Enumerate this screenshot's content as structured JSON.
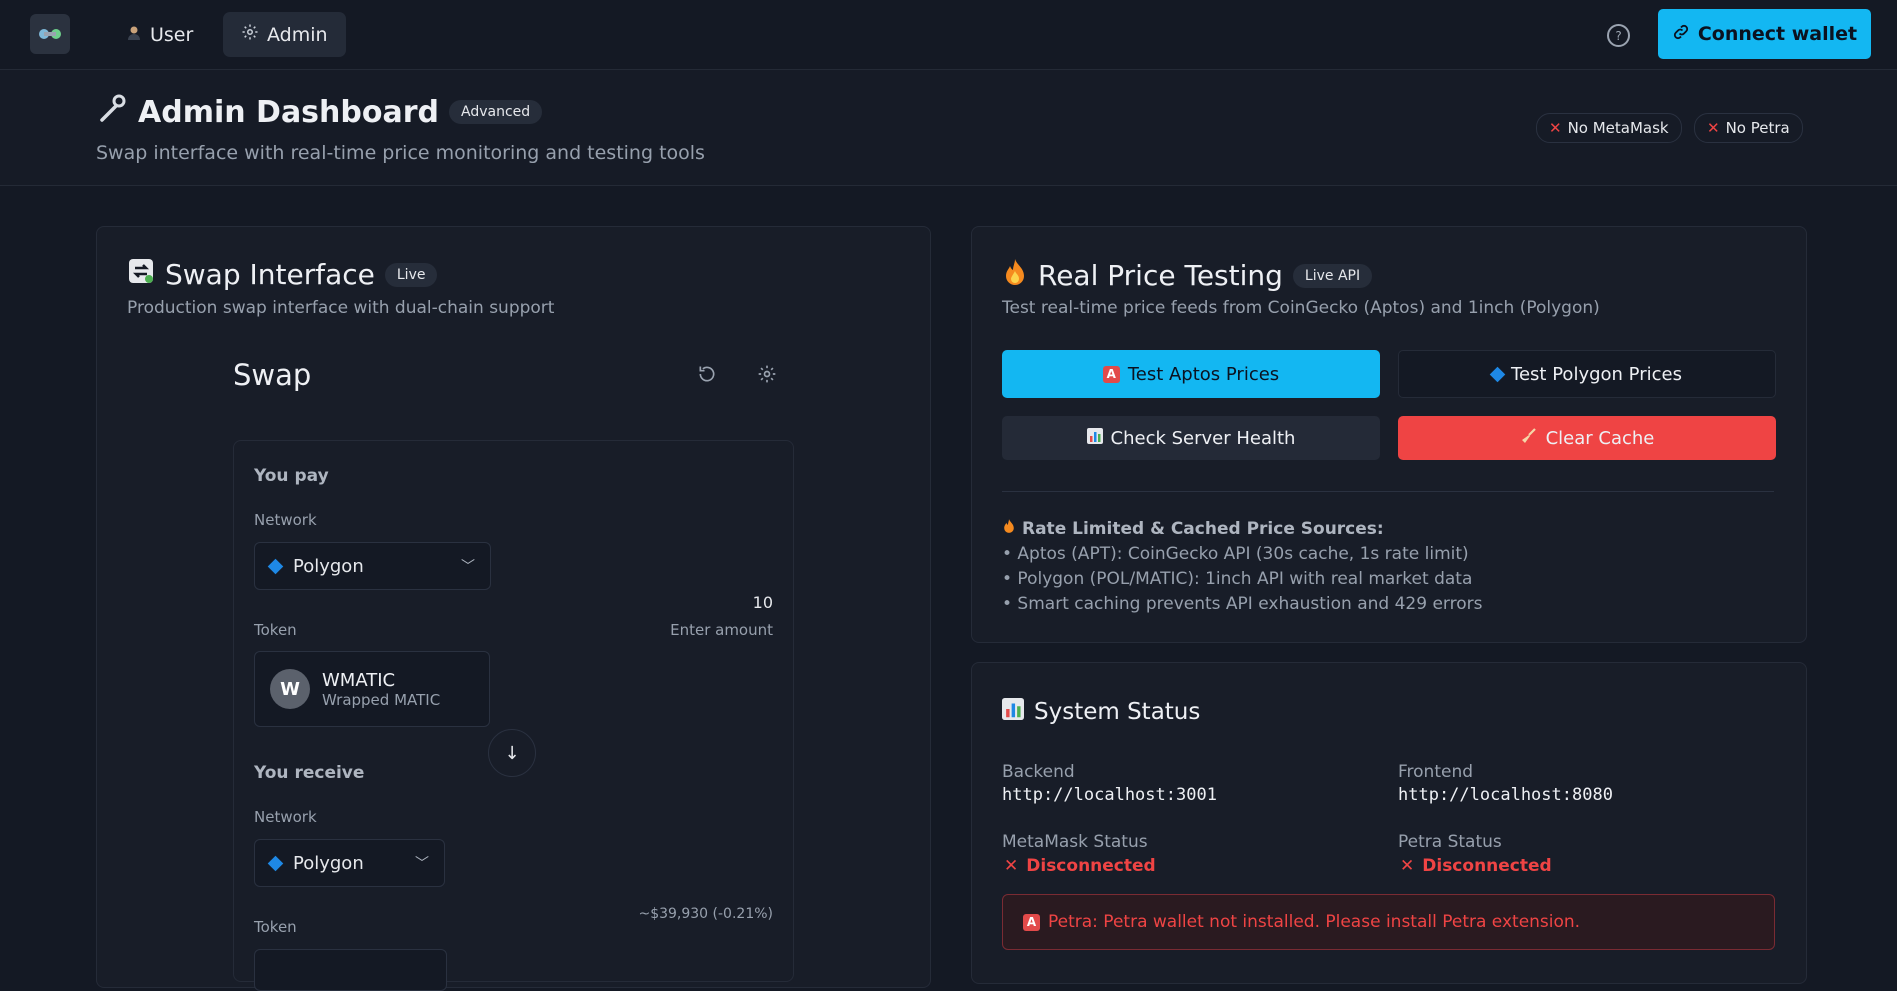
{
  "topbar": {
    "nav": [
      {
        "label": "User",
        "icon": "user-icon"
      },
      {
        "label": "Admin",
        "icon": "gear-icon"
      }
    ],
    "connect_label": "Connect wallet"
  },
  "header": {
    "title": "Admin Dashboard",
    "badge": "Advanced",
    "subtitle": "Swap interface with real-time price monitoring and testing tools",
    "status_badges": [
      "No MetaMask",
      "No Petra"
    ]
  },
  "swap_card": {
    "title": "Swap Interface",
    "badge": "Live",
    "subtitle": "Production swap interface with dual-chain support",
    "swap_title": "Swap",
    "pay": {
      "label": "You pay",
      "network_label": "Network",
      "network": "Polygon",
      "token_label": "Token",
      "token_symbol": "WMATIC",
      "token_name": "Wrapped MATIC",
      "token_initial": "W",
      "amount": "10",
      "amount_placeholder": "Enter amount"
    },
    "receive": {
      "label": "You receive",
      "network_label": "Network",
      "network": "Polygon",
      "token_label": "Token",
      "price_note": "~$39,930 (-0.21%)"
    }
  },
  "price_card": {
    "title": "Real Price Testing",
    "badge": "Live API",
    "subtitle": "Test real-time price feeds from CoinGecko (Aptos) and 1inch (Polygon)",
    "buttons": {
      "aptos": "Test Aptos Prices",
      "polygon": "Test Polygon Prices",
      "health": "Check Server Health",
      "clear": "Clear Cache"
    },
    "info_title": "Rate Limited & Cached Price Sources:",
    "info_lines": [
      "• Aptos (APT): CoinGecko API (30s cache, 1s rate limit)",
      "• Polygon (POL/MATIC): 1inch API with real market data",
      "• Smart caching prevents API exhaustion and 429 errors"
    ]
  },
  "status_card": {
    "title": "System Status",
    "backend_label": "Backend",
    "backend_value": "http://localhost:3001",
    "frontend_label": "Frontend",
    "frontend_value": "http://localhost:8080",
    "metamask_label": "MetaMask Status",
    "metamask_value": "Disconnected",
    "petra_label": "Petra Status",
    "petra_value": "Disconnected",
    "alert": "Petra: Petra wallet not installed. Please install Petra extension."
  },
  "colors": {
    "accent": "#13b7f2",
    "danger": "#ef4444",
    "background": "#141924"
  }
}
